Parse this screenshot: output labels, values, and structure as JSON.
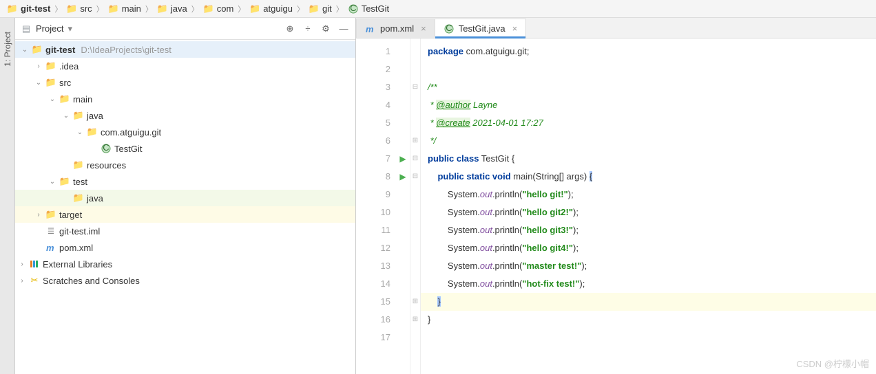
{
  "breadcrumb": [
    {
      "icon": "folder-blue",
      "label": "git-test",
      "bold": true
    },
    {
      "icon": "folder-gray",
      "label": "src"
    },
    {
      "icon": "folder-gray",
      "label": "main"
    },
    {
      "icon": "folder-cyan",
      "label": "java"
    },
    {
      "icon": "folder-gray",
      "label": "com"
    },
    {
      "icon": "folder-gray",
      "label": "atguigu"
    },
    {
      "icon": "folder-gray",
      "label": "git"
    },
    {
      "icon": "class",
      "label": "TestGit"
    }
  ],
  "sidebar": {
    "tab": "1: Project"
  },
  "project": {
    "title": "Project",
    "toolbarIcons": [
      "target",
      "divide",
      "gear",
      "hide"
    ],
    "tree": [
      {
        "depth": 0,
        "tw": "v",
        "icon": "folder-blue",
        "label": "git-test",
        "extra": "D:\\IdeaProjects\\git-test",
        "bold": true,
        "sel": true
      },
      {
        "depth": 1,
        "tw": ">",
        "icon": "folder-gray",
        "label": ".idea"
      },
      {
        "depth": 1,
        "tw": "v",
        "icon": "folder-gray",
        "label": "src"
      },
      {
        "depth": 2,
        "tw": "v",
        "icon": "folder-gray",
        "label": "main"
      },
      {
        "depth": 3,
        "tw": "v",
        "icon": "folder-cyan",
        "label": "java"
      },
      {
        "depth": 4,
        "tw": "v",
        "icon": "folder-gray",
        "label": "com.atguigu.git"
      },
      {
        "depth": 5,
        "tw": "",
        "icon": "class",
        "label": "TestGit"
      },
      {
        "depth": 3,
        "tw": "",
        "icon": "folder-gray",
        "label": "resources"
      },
      {
        "depth": 2,
        "tw": "v",
        "icon": "folder-gray",
        "label": "test"
      },
      {
        "depth": 3,
        "tw": "",
        "icon": "folder-cyan",
        "label": "java",
        "hl": "green"
      },
      {
        "depth": 1,
        "tw": ">",
        "icon": "folder-orange",
        "label": "target",
        "hl": "yellow"
      },
      {
        "depth": 1,
        "tw": "",
        "icon": "file",
        "label": "git-test.iml"
      },
      {
        "depth": 1,
        "tw": "",
        "icon": "maven",
        "label": "pom.xml"
      },
      {
        "depth": 0,
        "tw": ">",
        "icon": "lib",
        "label": "External Libraries",
        "pad": -1
      },
      {
        "depth": 0,
        "tw": ">",
        "icon": "scratch",
        "label": "Scratches and Consoles",
        "pad": -1
      }
    ]
  },
  "editorTabs": [
    {
      "icon": "maven",
      "label": "pom.xml",
      "active": false
    },
    {
      "icon": "class",
      "label": "TestGit.java",
      "active": true
    }
  ],
  "code": {
    "lines": 17,
    "runMarks": {
      "7": true,
      "8": true
    },
    "content": [
      {
        "t": [
          {
            "c": "kw",
            "s": "package"
          },
          {
            "c": "",
            "s": " com.atguigu.git;"
          }
        ]
      },
      {
        "t": []
      },
      {
        "t": [
          {
            "c": "doc",
            "s": "/**"
          }
        ]
      },
      {
        "t": [
          {
            "c": "doc",
            "s": " * "
          },
          {
            "c": "tag",
            "s": "@author"
          },
          {
            "c": "doc",
            "s": " Layne"
          }
        ]
      },
      {
        "t": [
          {
            "c": "doc",
            "s": " * "
          },
          {
            "c": "tag",
            "s": "@create"
          },
          {
            "c": "doc",
            "s": " 2021-04-01 17:27"
          }
        ]
      },
      {
        "t": [
          {
            "c": "doc",
            "s": " */"
          }
        ]
      },
      {
        "t": [
          {
            "c": "kw",
            "s": "public class"
          },
          {
            "c": "",
            "s": " TestGit {"
          }
        ]
      },
      {
        "t": [
          {
            "c": "",
            "s": "    "
          },
          {
            "c": "kw",
            "s": "public static void"
          },
          {
            "c": "",
            "s": " main(String[] args) "
          },
          {
            "c": "caret",
            "s": "{"
          }
        ]
      },
      {
        "t": [
          {
            "c": "",
            "s": "        System."
          },
          {
            "c": "fld",
            "s": "out"
          },
          {
            "c": "",
            "s": ".println("
          },
          {
            "c": "str",
            "s": "\"hello git!\""
          },
          {
            "c": "",
            "s": ");"
          }
        ]
      },
      {
        "t": [
          {
            "c": "",
            "s": "        System."
          },
          {
            "c": "fld",
            "s": "out"
          },
          {
            "c": "",
            "s": ".println("
          },
          {
            "c": "str",
            "s": "\"hello git2!\""
          },
          {
            "c": "",
            "s": ");"
          }
        ]
      },
      {
        "t": [
          {
            "c": "",
            "s": "        System."
          },
          {
            "c": "fld",
            "s": "out"
          },
          {
            "c": "",
            "s": ".println("
          },
          {
            "c": "str",
            "s": "\"hello git3!\""
          },
          {
            "c": "",
            "s": ");"
          }
        ]
      },
      {
        "t": [
          {
            "c": "",
            "s": "        System."
          },
          {
            "c": "fld",
            "s": "out"
          },
          {
            "c": "",
            "s": ".println("
          },
          {
            "c": "str",
            "s": "\"hello git4!\""
          },
          {
            "c": "",
            "s": ");"
          }
        ]
      },
      {
        "t": [
          {
            "c": "",
            "s": "        System."
          },
          {
            "c": "fld",
            "s": "out"
          },
          {
            "c": "",
            "s": ".println("
          },
          {
            "c": "str",
            "s": "\"master test!\""
          },
          {
            "c": "",
            "s": ");"
          }
        ]
      },
      {
        "t": [
          {
            "c": "",
            "s": "        System."
          },
          {
            "c": "fld",
            "s": "out"
          },
          {
            "c": "",
            "s": ".println("
          },
          {
            "c": "str",
            "s": "\"hot-fix test!\""
          },
          {
            "c": "",
            "s": ");"
          }
        ]
      },
      {
        "hl": true,
        "t": [
          {
            "c": "",
            "s": "    "
          },
          {
            "c": "caret",
            "s": "}"
          }
        ]
      },
      {
        "t": [
          {
            "c": "",
            "s": "}"
          }
        ]
      },
      {
        "t": []
      }
    ]
  },
  "watermark": "CSDN @柠檬小帽"
}
